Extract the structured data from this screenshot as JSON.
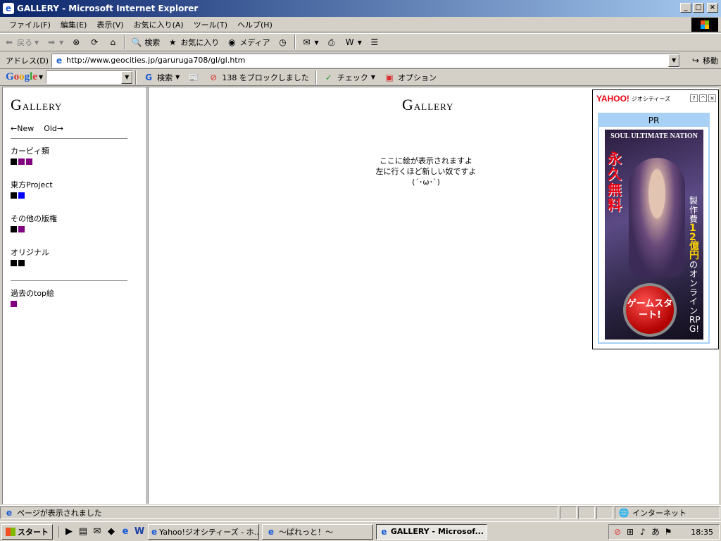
{
  "window": {
    "title": "GALLERY - Microsoft Internet Explorer"
  },
  "menu": {
    "items": [
      "ファイル(F)",
      "編集(E)",
      "表示(V)",
      "お気に入り(A)",
      "ツール(T)",
      "ヘルプ(H)"
    ]
  },
  "toolbar": {
    "back": "戻る",
    "search": "検索",
    "favorites": "お気に入り",
    "media": "メディア"
  },
  "address": {
    "label": "アドレス(D)",
    "url": "http://www.geocities.jp/garuruga708/gl/gl.htm",
    "go": "移動"
  },
  "google": {
    "search": "検索",
    "blocked": "138 をブロックしました",
    "check": "チェック",
    "options": "オプション"
  },
  "left": {
    "logo_initial": "G",
    "logo_rest": "ALLERY",
    "nav_new": "←New",
    "nav_old": "Old→",
    "categories": [
      {
        "title": "カービィ類",
        "squares": [
          "#000000",
          "#800080",
          "#800080"
        ]
      },
      {
        "title": "東方Project",
        "squares": [
          "#000000",
          "#0000ff"
        ]
      },
      {
        "title": "その他の版権",
        "squares": [
          "#000000",
          "#800080"
        ]
      },
      {
        "title": "オリジナル",
        "squares": [
          "#000000",
          "#000000"
        ]
      }
    ],
    "past": {
      "title": "過去のtop絵",
      "squares": [
        "#800080"
      ]
    }
  },
  "main": {
    "logo_initial": "G",
    "logo_rest": "ALLERY",
    "line1": "ここに絵が表示されますよ",
    "line2": "左に行くほど新しい奴ですよ",
    "line3": "(´･ω･`)"
  },
  "ad": {
    "brand": "YAHOO!",
    "service": "ジオシティーズ",
    "pr": "PR",
    "banner_title": "SOUL ULTIMATE NATION",
    "banner_left": "永久無料",
    "banner_right_1": "製作費",
    "banner_right_hl": "12億円",
    "banner_right_2": "のオンラインRPG!",
    "start_button": "ゲームスタート!"
  },
  "status": {
    "text": "ページが表示されました",
    "zone": "インターネット"
  },
  "taskbar": {
    "start": "スタート",
    "tasks": [
      "Yahoo!ジオシティーズ - ホ...",
      "～ぱれっと！～",
      "GALLERY - Microsof..."
    ],
    "clock": "18:35"
  }
}
